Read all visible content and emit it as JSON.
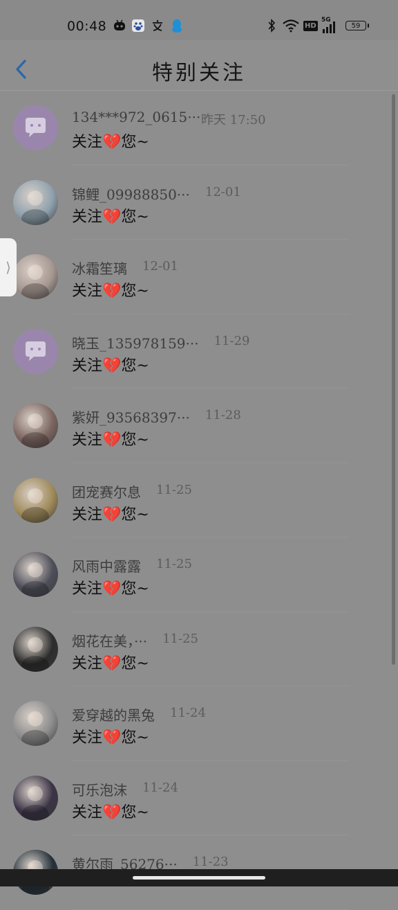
{
  "status_bar": {
    "time": "00:48",
    "hd_label": "HD",
    "network_label": "5G",
    "battery_level": "59"
  },
  "header": {
    "title": "特别关注"
  },
  "items": [
    {
      "name": "134***972_0615···",
      "date": "昨天 17:50",
      "message": "关注💔您~",
      "avatar": "chat-bubble-placeholder",
      "avatar_color": "#9a86ad"
    },
    {
      "name": "锦鲤_09988850···",
      "date": "12-01",
      "message": "关注💔您~",
      "avatar": "anime-girl-blue",
      "avatar_color": "#8ea0ad"
    },
    {
      "name": "冰霜笙璃",
      "date": "12-01",
      "message": "关注💔您~",
      "avatar": "anime-girl-pale",
      "avatar_color": "#a59690"
    },
    {
      "name": "晓玉_135978159···",
      "date": "11-29",
      "message": "关注💔您~",
      "avatar": "chat-bubble-placeholder",
      "avatar_color": "#9a86ad"
    },
    {
      "name": "紫妍_93568397···",
      "date": "11-28",
      "message": "关注💔您~",
      "avatar": "anime-girl-brown",
      "avatar_color": "#7c6560"
    },
    {
      "name": "团宠赛尔息",
      "date": "11-25",
      "message": "关注💔您~",
      "avatar": "anime-girl-yellow",
      "avatar_color": "#a08a5a"
    },
    {
      "name": "风雨中露露",
      "date": "11-25",
      "message": "关注💔您~",
      "avatar": "couple-photo",
      "avatar_color": "#4e4e5a"
    },
    {
      "name": "烟花在美，···",
      "date": "11-25",
      "message": "关注💔您~",
      "avatar": "dark-photo",
      "avatar_color": "#2c2c2c"
    },
    {
      "name": "爱穿越的黑兔",
      "date": "11-24",
      "message": "关注💔您~",
      "avatar": "heart-art",
      "avatar_color": "#8c8c8c"
    },
    {
      "name": "可乐泡沫",
      "date": "11-24",
      "message": "关注💔您~",
      "avatar": "hooded-figure",
      "avatar_color": "#3a3345"
    },
    {
      "name": "黄尔雨_56276···",
      "date": "11-23",
      "message": "",
      "avatar": "dark-photo",
      "avatar_color": "#25303a"
    }
  ],
  "side_handle": {
    "glyph": "⟩"
  },
  "colors": {
    "accent": "#2a66a8",
    "overlay": "#8e8e8e"
  }
}
